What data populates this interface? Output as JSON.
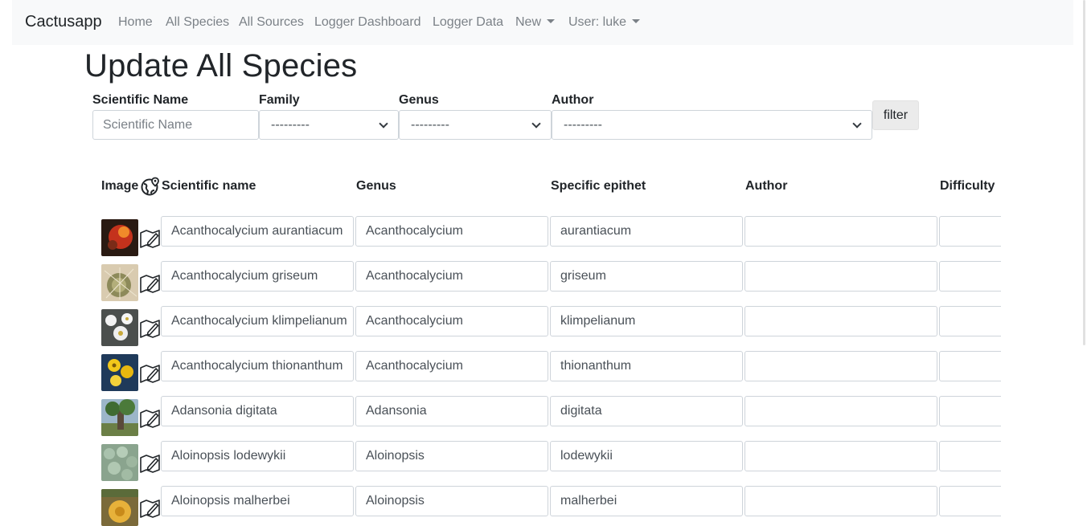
{
  "navbar": {
    "brand": "Cactusapp",
    "links": [
      "Home",
      "All Species",
      "All Sources",
      "Logger Dashboard",
      "Logger Data"
    ],
    "new_label": "New",
    "user_label": "User: luke"
  },
  "page": {
    "title": "Update All Species"
  },
  "filters": {
    "scientific_name": {
      "label": "Scientific Name",
      "placeholder": "Scientific Name"
    },
    "family": {
      "label": "Family",
      "value": "---------"
    },
    "genus": {
      "label": "Genus",
      "value": "---------"
    },
    "author": {
      "label": "Author",
      "value": "---------"
    },
    "filter_button": "filter"
  },
  "table": {
    "headers": {
      "image": "Image",
      "scientific_name": "Scientific name",
      "genus": "Genus",
      "specific_epithet": "Specific epithet",
      "author": "Author",
      "difficulty": "Difficulty"
    },
    "rows": [
      {
        "scientific_name": "Acanthocalycium aurantiacum",
        "genus": "Acanthocalycium",
        "specific_epithet": "aurantiacum",
        "author": "",
        "difficulty": ""
      },
      {
        "scientific_name": "Acanthocalycium griseum",
        "genus": "Acanthocalycium",
        "specific_epithet": "griseum",
        "author": "",
        "difficulty": ""
      },
      {
        "scientific_name": "Acanthocalycium klimpelianum",
        "genus": "Acanthocalycium",
        "specific_epithet": "klimpelianum",
        "author": "",
        "difficulty": ""
      },
      {
        "scientific_name": "Acanthocalycium thionanthum",
        "genus": "Acanthocalycium",
        "specific_epithet": "thionanthum",
        "author": "",
        "difficulty": ""
      },
      {
        "scientific_name": "Adansonia digitata",
        "genus": "Adansonia",
        "specific_epithet": "digitata",
        "author": "",
        "difficulty": ""
      },
      {
        "scientific_name": "Aloinopsis lodewykii",
        "genus": "Aloinopsis",
        "specific_epithet": "lodewykii",
        "author": "",
        "difficulty": ""
      },
      {
        "scientific_name": "Aloinopsis malherbei",
        "genus": "Aloinopsis",
        "specific_epithet": "malherbei",
        "author": "",
        "difficulty": ""
      }
    ]
  },
  "icons": {
    "header_icon": "globe-pin-icon",
    "row_icon": "map-edit-icon"
  }
}
